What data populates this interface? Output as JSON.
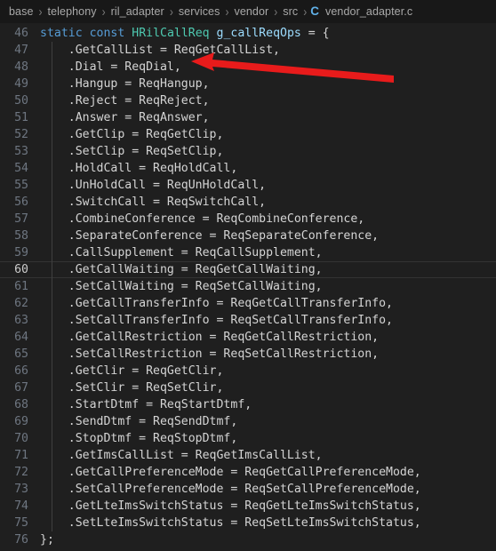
{
  "breadcrumb": {
    "separator": "›",
    "items": [
      {
        "label": "base",
        "icon": null
      },
      {
        "label": "telephony",
        "icon": null
      },
      {
        "label": "ril_adapter",
        "icon": null
      },
      {
        "label": "services",
        "icon": null
      },
      {
        "label": "vendor",
        "icon": null
      },
      {
        "label": "src",
        "icon": null
      }
    ],
    "file": {
      "icon_letter": "C",
      "icon_name": "c-file-icon",
      "label": "vendor_adapter.c"
    }
  },
  "editor": {
    "active_line": 60,
    "colors": {
      "background": "#1f1f1f",
      "breadcrumb_background": "#181818",
      "line_number": "#6e7681",
      "line_number_active": "#cccccc",
      "text": "#d4d4d4",
      "keyword": "#569cd6",
      "type": "#4ec9b0",
      "variable": "#9cdcfe",
      "indent_guide": "#404040",
      "arrow": "#e81b1b"
    },
    "lines": [
      {
        "n": "46",
        "indent": 0,
        "tokens": [
          {
            "t": "static",
            "c": "kw"
          },
          {
            "t": " ",
            "c": "id"
          },
          {
            "t": "const",
            "c": "kw"
          },
          {
            "t": " ",
            "c": "id"
          },
          {
            "t": "HRilCallReq",
            "c": "type"
          },
          {
            "t": " ",
            "c": "id"
          },
          {
            "t": "g_callReqOps",
            "c": "var"
          },
          {
            "t": " = {",
            "c": "punc"
          }
        ]
      },
      {
        "n": "47",
        "indent": 1,
        "tokens": [
          {
            "t": ".GetCallList = ReqGetCallList,",
            "c": "id"
          }
        ]
      },
      {
        "n": "48",
        "indent": 1,
        "tokens": [
          {
            "t": ".Dial = ReqDial,",
            "c": "id"
          }
        ]
      },
      {
        "n": "49",
        "indent": 1,
        "tokens": [
          {
            "t": ".Hangup = ReqHangup,",
            "c": "id"
          }
        ]
      },
      {
        "n": "50",
        "indent": 1,
        "tokens": [
          {
            "t": ".Reject = ReqReject,",
            "c": "id"
          }
        ]
      },
      {
        "n": "51",
        "indent": 1,
        "tokens": [
          {
            "t": ".Answer = ReqAnswer,",
            "c": "id"
          }
        ]
      },
      {
        "n": "52",
        "indent": 1,
        "tokens": [
          {
            "t": ".GetClip = ReqGetClip,",
            "c": "id"
          }
        ]
      },
      {
        "n": "53",
        "indent": 1,
        "tokens": [
          {
            "t": ".SetClip = ReqSetClip,",
            "c": "id"
          }
        ]
      },
      {
        "n": "54",
        "indent": 1,
        "tokens": [
          {
            "t": ".HoldCall = ReqHoldCall,",
            "c": "id"
          }
        ]
      },
      {
        "n": "55",
        "indent": 1,
        "tokens": [
          {
            "t": ".UnHoldCall = ReqUnHoldCall,",
            "c": "id"
          }
        ]
      },
      {
        "n": "56",
        "indent": 1,
        "tokens": [
          {
            "t": ".SwitchCall = ReqSwitchCall,",
            "c": "id"
          }
        ]
      },
      {
        "n": "57",
        "indent": 1,
        "tokens": [
          {
            "t": ".CombineConference = ReqCombineConference,",
            "c": "id"
          }
        ]
      },
      {
        "n": "58",
        "indent": 1,
        "tokens": [
          {
            "t": ".SeparateConference = ReqSeparateConference,",
            "c": "id"
          }
        ]
      },
      {
        "n": "59",
        "indent": 1,
        "tokens": [
          {
            "t": ".CallSupplement = ReqCallSupplement,",
            "c": "id"
          }
        ]
      },
      {
        "n": "60",
        "indent": 1,
        "active": true,
        "tokens": [
          {
            "t": ".GetCallWaiting = ReqGetCallWaiting,",
            "c": "id"
          }
        ]
      },
      {
        "n": "61",
        "indent": 1,
        "tokens": [
          {
            "t": ".SetCallWaiting = ReqSetCallWaiting,",
            "c": "id"
          }
        ]
      },
      {
        "n": "62",
        "indent": 1,
        "tokens": [
          {
            "t": ".GetCallTransferInfo = ReqGetCallTransferInfo,",
            "c": "id"
          }
        ]
      },
      {
        "n": "63",
        "indent": 1,
        "tokens": [
          {
            "t": ".SetCallTransferInfo = ReqSetCallTransferInfo,",
            "c": "id"
          }
        ]
      },
      {
        "n": "64",
        "indent": 1,
        "tokens": [
          {
            "t": ".GetCallRestriction = ReqGetCallRestriction,",
            "c": "id"
          }
        ]
      },
      {
        "n": "65",
        "indent": 1,
        "tokens": [
          {
            "t": ".SetCallRestriction = ReqSetCallRestriction,",
            "c": "id"
          }
        ]
      },
      {
        "n": "66",
        "indent": 1,
        "tokens": [
          {
            "t": ".GetClir = ReqGetClir,",
            "c": "id"
          }
        ]
      },
      {
        "n": "67",
        "indent": 1,
        "tokens": [
          {
            "t": ".SetClir = ReqSetClir,",
            "c": "id"
          }
        ]
      },
      {
        "n": "68",
        "indent": 1,
        "tokens": [
          {
            "t": ".StartDtmf = ReqStartDtmf,",
            "c": "id"
          }
        ]
      },
      {
        "n": "69",
        "indent": 1,
        "tokens": [
          {
            "t": ".SendDtmf = ReqSendDtmf,",
            "c": "id"
          }
        ]
      },
      {
        "n": "70",
        "indent": 1,
        "tokens": [
          {
            "t": ".StopDtmf = ReqStopDtmf,",
            "c": "id"
          }
        ]
      },
      {
        "n": "71",
        "indent": 1,
        "tokens": [
          {
            "t": ".GetImsCallList = ReqGetImsCallList,",
            "c": "id"
          }
        ]
      },
      {
        "n": "72",
        "indent": 1,
        "tokens": [
          {
            "t": ".GetCallPreferenceMode = ReqGetCallPreferenceMode,",
            "c": "id"
          }
        ]
      },
      {
        "n": "73",
        "indent": 1,
        "tokens": [
          {
            "t": ".SetCallPreferenceMode = ReqSetCallPreferenceMode,",
            "c": "id"
          }
        ]
      },
      {
        "n": "74",
        "indent": 1,
        "tokens": [
          {
            "t": ".GetLteImsSwitchStatus = ReqGetLteImsSwitchStatus,",
            "c": "id"
          }
        ]
      },
      {
        "n": "75",
        "indent": 1,
        "tokens": [
          {
            "t": ".SetLteImsSwitchStatus = ReqSetLteImsSwitchStatus,",
            "c": "id"
          }
        ]
      },
      {
        "n": "76",
        "indent": 0,
        "tokens": [
          {
            "t": "};",
            "c": "brc"
          }
        ]
      }
    ]
  },
  "annotation": {
    "name": "red-arrow-pointing-to-dial-line",
    "color": "#e81b1b",
    "target_line": "48",
    "target_text": ".Dial = ReqDial,"
  }
}
